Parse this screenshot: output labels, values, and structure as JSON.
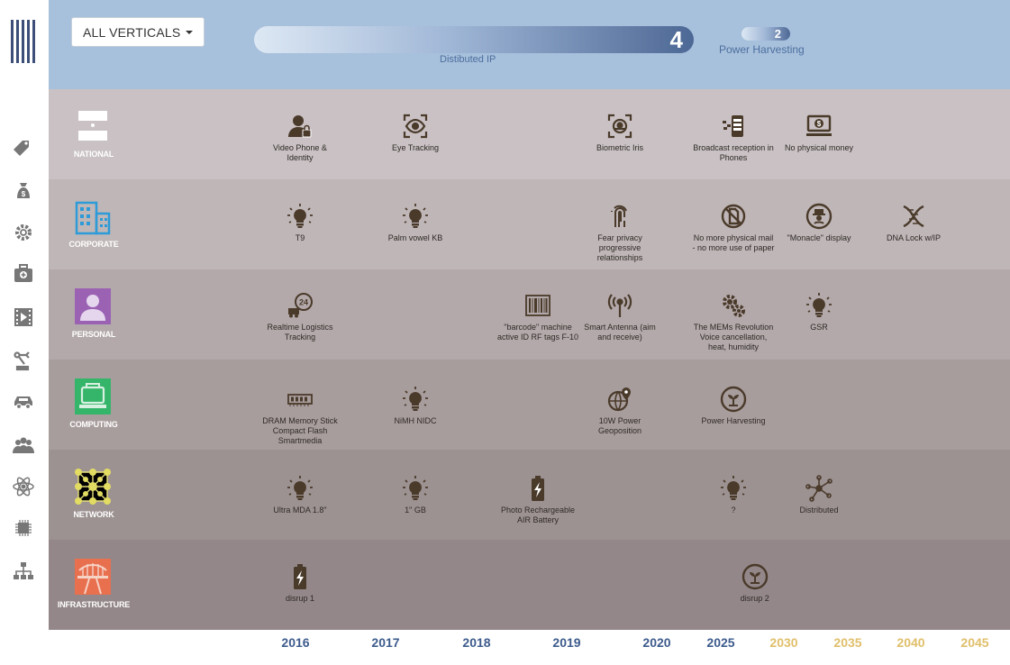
{
  "filter": {
    "label": "ALL VERTICALS"
  },
  "summary": {
    "bar1": {
      "count": "4",
      "label": "Distibuted IP",
      "fill": 1.0
    },
    "bar2": {
      "count": "2",
      "label": "Power Harvesting",
      "fill": 0.5
    }
  },
  "sidebar": [
    {
      "name": "tag-icon"
    },
    {
      "name": "money-bag-icon"
    },
    {
      "name": "gear-icon"
    },
    {
      "name": "medical-kit-icon"
    },
    {
      "name": "film-icon"
    },
    {
      "name": "robot-arm-icon"
    },
    {
      "name": "car-icon"
    },
    {
      "name": "people-icon"
    },
    {
      "name": "atom-icon"
    },
    {
      "name": "chip-icon"
    },
    {
      "name": "sitemap-icon"
    }
  ],
  "colors": {
    "header": "#a7c0dc",
    "rows": [
      "#c9c1c3",
      "#bfb6b7",
      "#b3a9aa",
      "#a89d9d",
      "#9d9292",
      "#938789"
    ],
    "year_blue": "#3d5b8c",
    "year_gold": "#e0bf6a",
    "icon": "#4a3a2a"
  },
  "categories": [
    {
      "id": "national",
      "label": "NATIONAL",
      "icon": "flag-icon",
      "items": [
        {
          "col": 0,
          "label": "Video Phone &\nIdentity",
          "icon": "user-lock-icon"
        },
        {
          "col": 1,
          "label": "Eye Tracking",
          "icon": "eye-scan-icon"
        },
        {
          "col": 3,
          "label": "Biometric Iris",
          "icon": "iris-scan-icon"
        },
        {
          "col": 4,
          "label": "Broadcast reception in\nPhones",
          "icon": "broadcast-icon"
        },
        {
          "col": 5,
          "label": "No physical money",
          "icon": "money-screen-icon"
        }
      ]
    },
    {
      "id": "corporate",
      "label": "CORPORATE",
      "icon": "building-icon",
      "items": [
        {
          "col": 0,
          "label": "T9",
          "icon": "lightbulb-icon"
        },
        {
          "col": 1,
          "label": "Palm vowel KB",
          "icon": "lightbulb-icon"
        },
        {
          "col": 3,
          "label": "Fear privacy\nprogressive\nrelationships",
          "icon": "fingerprint-icon"
        },
        {
          "col": 4,
          "label": "No more physical mail\n- no more use of paper",
          "icon": "no-paper-icon"
        },
        {
          "col": 5,
          "label": "\"Monacle\" display",
          "icon": "monocle-icon"
        },
        {
          "col": 6,
          "label": "DNA Lock w/IP",
          "icon": "dna-icon"
        }
      ]
    },
    {
      "id": "personal",
      "label": "PERSONAL",
      "icon": "person-icon",
      "items": [
        {
          "col": 0,
          "label": "Realtime Logistics\nTracking",
          "icon": "delivery-24-icon"
        },
        {
          "col": 2,
          "label": "\"barcode\" machine\nactive ID RF tags F-10",
          "icon": "barcode-icon"
        },
        {
          "col": 3,
          "label": "Smart Antenna (aim\nand receive)",
          "icon": "antenna-icon"
        },
        {
          "col": 4,
          "label": "The MEMs Revolution\nVoice cancellation,\nheat, humidity",
          "icon": "gears-icon"
        },
        {
          "col": 5,
          "label": "GSR",
          "icon": "lightbulb-icon"
        }
      ]
    },
    {
      "id": "computing",
      "label": "COMPUTING",
      "icon": "computer-icon",
      "items": [
        {
          "col": 0,
          "label": "DRAM Memory Stick\nCompact Flash\nSmartmedia",
          "icon": "memory-icon"
        },
        {
          "col": 1,
          "label": "NiMH NIDC",
          "icon": "lightbulb-icon"
        },
        {
          "col": 3,
          "label": "10W Power\nGeoposition",
          "icon": "globe-pin-icon"
        },
        {
          "col": 4,
          "label": "Power Harvesting",
          "icon": "plant-icon"
        }
      ]
    },
    {
      "id": "network",
      "label": "NETWORK",
      "icon": "network-grid-icon",
      "items": [
        {
          "col": 0,
          "label": "Ultra MDA 1.8\"",
          "icon": "lightbulb-icon"
        },
        {
          "col": 1,
          "label": "1\" GB",
          "icon": "lightbulb-icon"
        },
        {
          "col": 2,
          "label": "Photo Rechargeable\nAIR Battery",
          "icon": "battery-icon"
        },
        {
          "col": 4,
          "label": "?",
          "icon": "lightbulb-icon"
        },
        {
          "col": 5,
          "label": "Distributed",
          "icon": "distributed-icon"
        }
      ]
    },
    {
      "id": "infrastructure",
      "label": "INFRASTRUCTURE",
      "icon": "bridge-icon",
      "items": [
        {
          "col": 0,
          "label": "disrup 1",
          "icon": "battery-icon"
        },
        {
          "col": 4.25,
          "label": "disrup 2",
          "icon": "plant-icon"
        }
      ]
    }
  ],
  "years": [
    {
      "label": "2016",
      "tone": "blue"
    },
    {
      "label": "2017",
      "tone": "blue"
    },
    {
      "label": "2018",
      "tone": "blue"
    },
    {
      "label": "2019",
      "tone": "blue"
    },
    {
      "label": "2020",
      "tone": "blue"
    },
    {
      "label": "2025",
      "tone": "blue"
    },
    {
      "label": "2030",
      "tone": "gold"
    },
    {
      "label": "2035",
      "tone": "gold"
    },
    {
      "label": "2040",
      "tone": "gold"
    },
    {
      "label": "2045",
      "tone": "gold"
    }
  ]
}
